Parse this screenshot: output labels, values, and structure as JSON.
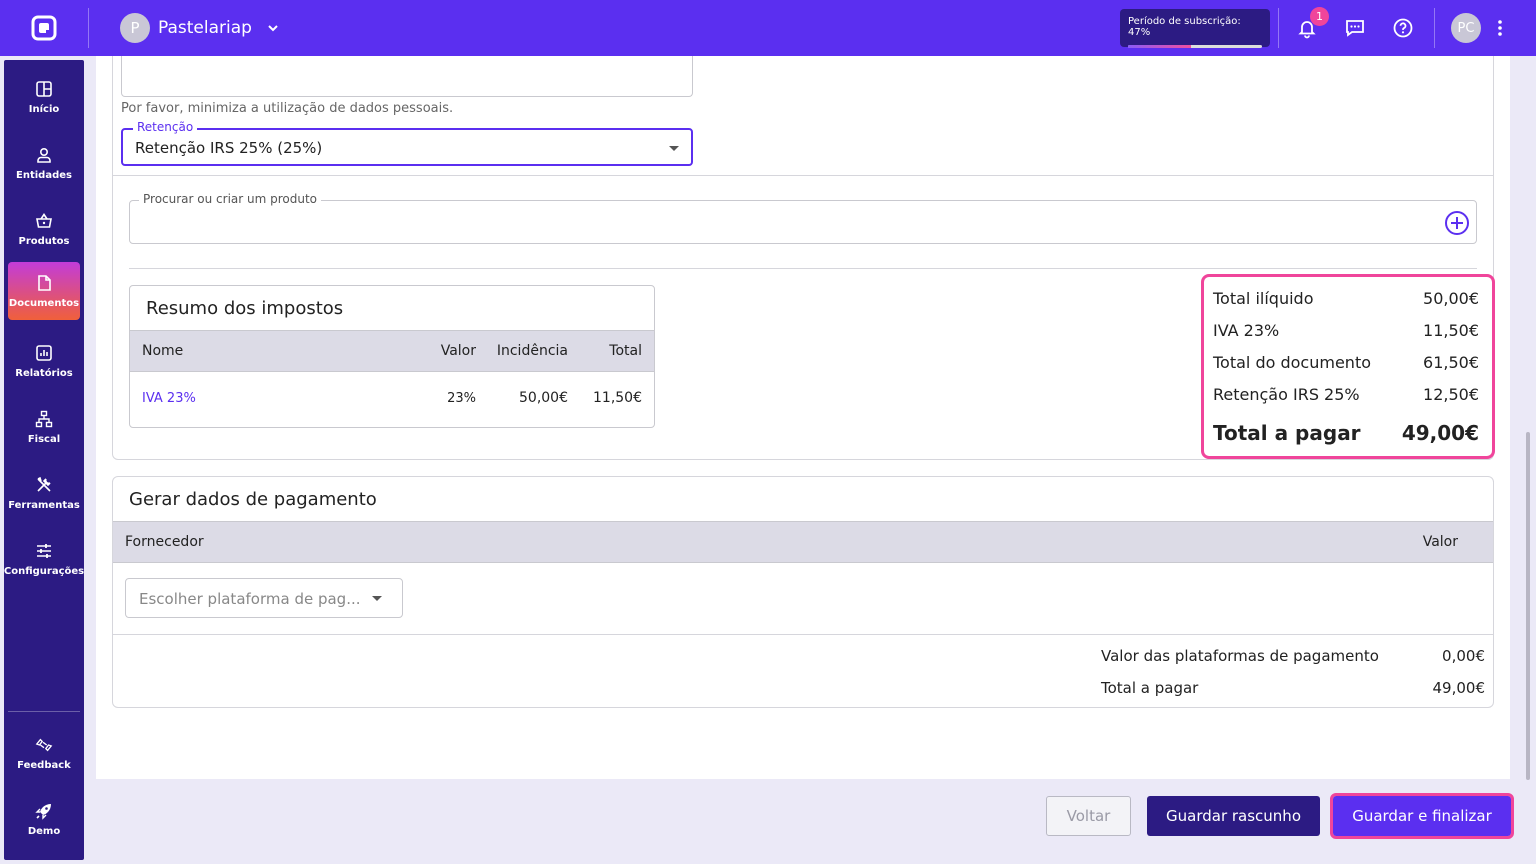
{
  "topbar": {
    "company_initial": "P",
    "company_name": "Pastelariap",
    "subscription_label": "Período de subscrição: 47%",
    "subscription_progress": 0.47,
    "notifications_count": "1",
    "user_initials": "PC"
  },
  "sidebar": {
    "items": [
      {
        "label": "Início",
        "icon": "grid-icon"
      },
      {
        "label": "Entidades",
        "icon": "user-icon"
      },
      {
        "label": "Produtos",
        "icon": "basket-icon"
      },
      {
        "label": "Documentos",
        "icon": "document-icon",
        "active": true
      },
      {
        "label": "Relatórios",
        "icon": "chart-icon"
      },
      {
        "label": "Fiscal",
        "icon": "hierarchy-icon"
      },
      {
        "label": "Ferramentas",
        "icon": "tools-icon"
      },
      {
        "label": "Configurações",
        "icon": "sliders-icon"
      }
    ],
    "bottom": [
      {
        "label": "Feedback",
        "icon": "feedback-icon"
      },
      {
        "label": "Demo",
        "icon": "rocket-icon"
      }
    ]
  },
  "form": {
    "privacy_hint": "Por favor, minimiza a utilização de dados pessoais.",
    "retention_label": "Retenção",
    "retention_value": "Retenção IRS 25% (25%)",
    "product_search_label": "Procurar ou criar um produto"
  },
  "tax_summary": {
    "title": "Resumo dos impostos",
    "headers": {
      "name": "Nome",
      "value": "Valor",
      "incidence": "Incidência",
      "total": "Total"
    },
    "rows": [
      {
        "name": "IVA 23%",
        "value": "23%",
        "incidence": "50,00€",
        "total": "11,50€"
      }
    ]
  },
  "totals": {
    "net_label": "Total ilíquido",
    "net_value": "50,00€",
    "vat_label": "IVA 23%",
    "vat_value": "11,50€",
    "doc_label": "Total do documento",
    "doc_value": "61,50€",
    "ret_label": "Retenção IRS 25%",
    "ret_value": "12,50€",
    "pay_label": "Total a pagar",
    "pay_value": "49,00€"
  },
  "payment": {
    "title": "Gerar dados de pagamento",
    "col_supplier": "Fornecedor",
    "col_value": "Valor",
    "platform_placeholder": "Escolher plataforma de pag...",
    "platforms_value_label": "Valor das plataformas de pagamento",
    "platforms_value": "0,00€",
    "total_label": "Total a pagar",
    "total_value": "49,00€"
  },
  "actions": {
    "back": "Voltar",
    "save_draft": "Guardar rascunho",
    "save_finalize": "Guardar e finalizar"
  },
  "colors": {
    "brand": "#5b2ff0",
    "sidebar": "#2c1b83",
    "highlight": "#f0459b"
  }
}
